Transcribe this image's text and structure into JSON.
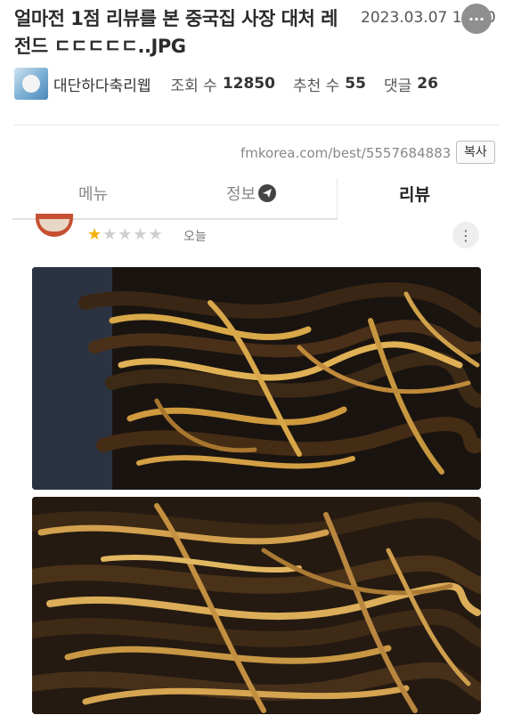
{
  "post": {
    "title": "얼마전 1점 리뷰를 본 중국집 사장 대처 레전드 ㄷㄷㄷㄷㄷ..JPG",
    "date": "2023.03.07 12:00",
    "more_icon": "ellipsis-icon",
    "author": "대단하다축리웹",
    "views_label": "조회 수",
    "views": "12850",
    "likes_label": "추천 수",
    "likes": "55",
    "comments_label": "댓글",
    "comments": "26"
  },
  "source": {
    "url": "fmkorea.com/best/5557684883",
    "copy_label": "복사"
  },
  "tabs": {
    "menu": "메뉴",
    "info": "정보",
    "review": "리뷰",
    "active": "review"
  },
  "review": {
    "rating": 1,
    "max_rating": 5,
    "stars_filled": "★",
    "stars_empty": "★★★★",
    "date": "오늘",
    "more_icon": "kebab-icon"
  },
  "photos": [
    {
      "subject": "jjajangmyeon-noodles-top"
    },
    {
      "subject": "jjajangmyeon-noodles-bottom"
    }
  ],
  "colors": {
    "star": "#f3b000",
    "star_empty": "#cfcfcf",
    "noodle": "#d7a345",
    "sauce": "#2a1c10"
  }
}
